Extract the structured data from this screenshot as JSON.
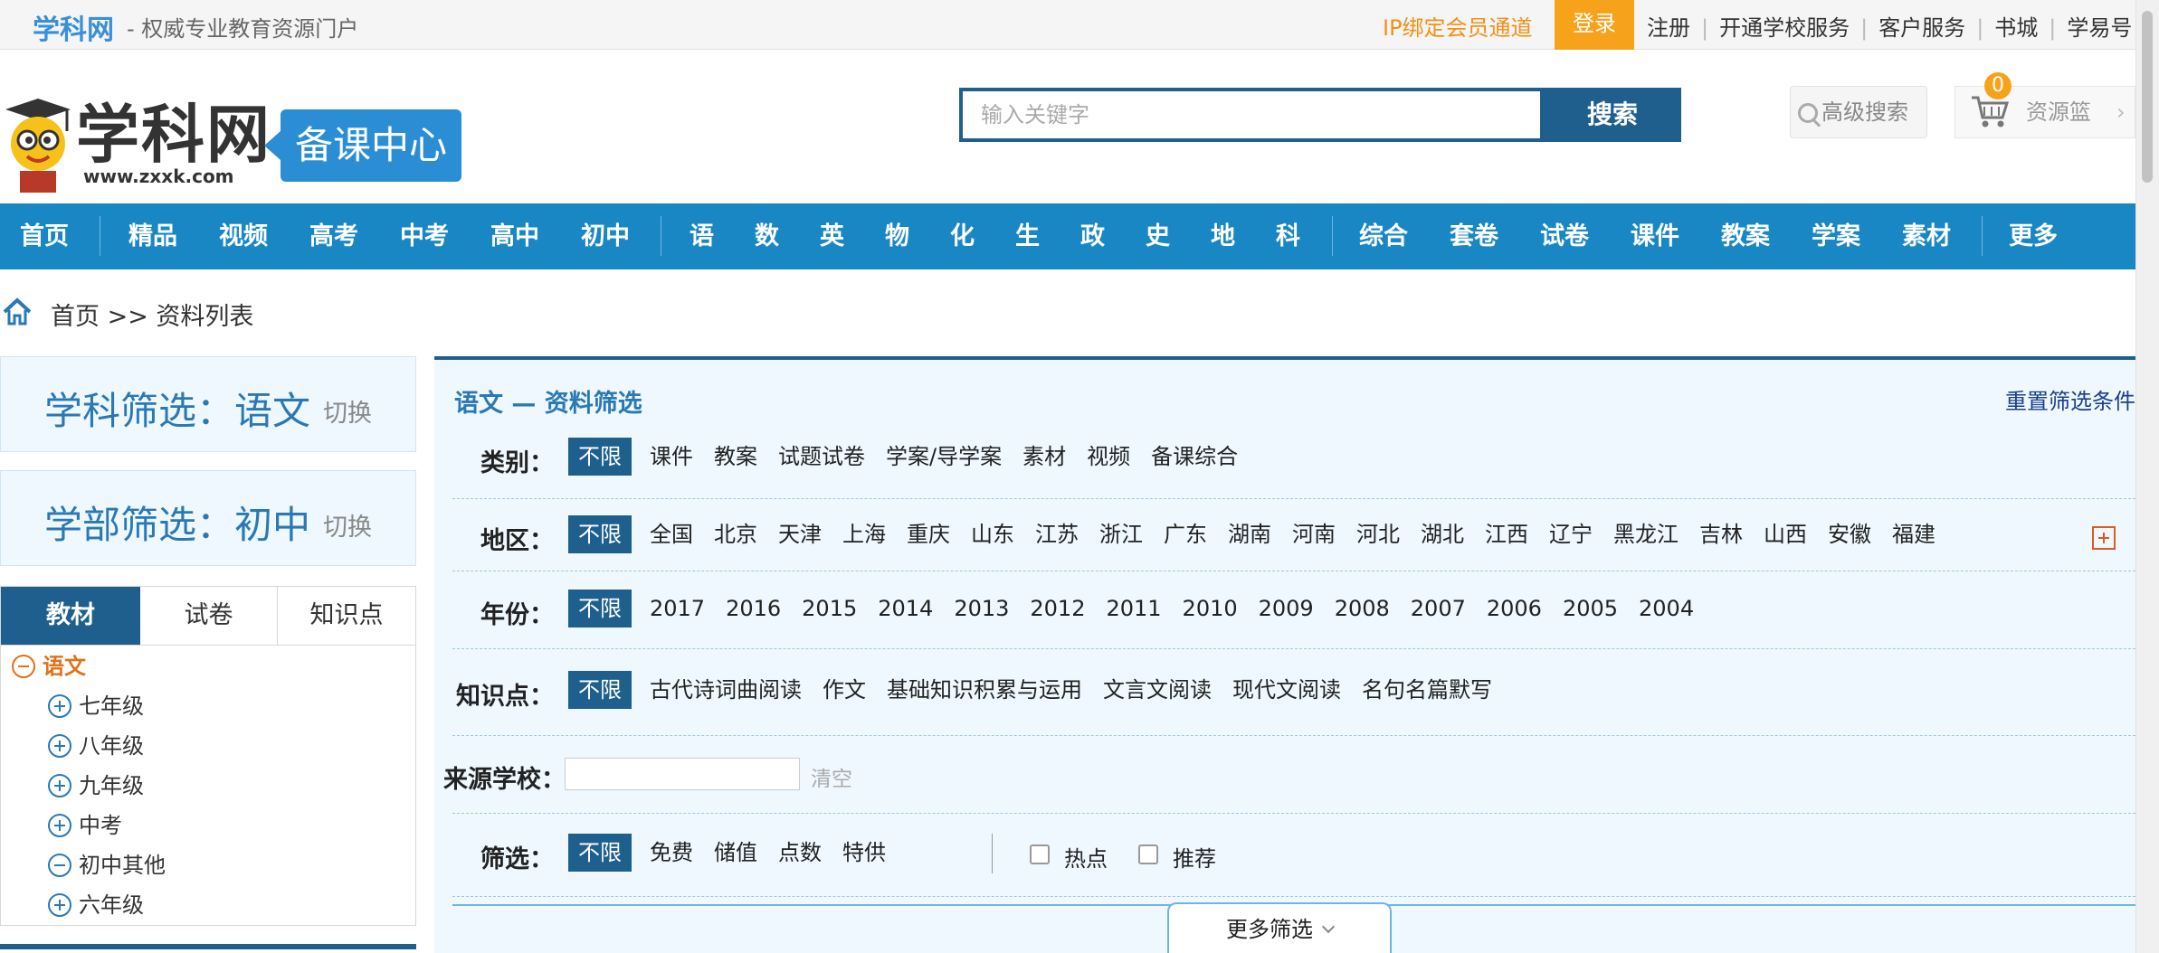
{
  "topbar": {
    "site_name": "学科网",
    "slogan": "- 权威专业教育资源门户",
    "ip_channel": "IP绑定会员通道",
    "login": "登录",
    "links": [
      "注册",
      "开通学校服务",
      "客户服务",
      "书城",
      "学易号"
    ]
  },
  "header": {
    "logo_text": "学科网",
    "logo_url": "www.zxxk.com",
    "badge": "备课中心",
    "search_placeholder": "输入关键字",
    "search_button": "搜索",
    "advanced_search": "高级搜索",
    "basket_count": "0",
    "basket_label": "资源篮",
    "basket_arrow": "›"
  },
  "nav": {
    "items": [
      "首页",
      "精品",
      "视频",
      "高考",
      "中考",
      "高中",
      "初中",
      "语",
      "数",
      "英",
      "物",
      "化",
      "生",
      "政",
      "史",
      "地",
      "科",
      "综合",
      "套卷",
      "试卷",
      "课件",
      "教案",
      "学案",
      "素材",
      "更多"
    ]
  },
  "breadcrumb": "首页 >> 资料列表",
  "left": {
    "subject_filter": "学科筛选：语文",
    "dept_filter": "学部筛选：初中",
    "switch": "切换",
    "tabs": [
      "教材",
      "试卷",
      "知识点"
    ],
    "tree_root": "语文",
    "tree_items": [
      "七年级",
      "八年级",
      "九年级",
      "中考",
      "初中其他",
      "六年级"
    ]
  },
  "panel": {
    "title": "语文 — 资料筛选",
    "reset": "重置筛选条件",
    "rows": {
      "category": {
        "label": "类别：",
        "options": [
          "不限",
          "课件",
          "教案",
          "试题试卷",
          "学案/导学案",
          "素材",
          "视频",
          "备课综合"
        ]
      },
      "region": {
        "label": "地区：",
        "options": [
          "不限",
          "全国",
          "北京",
          "天津",
          "上海",
          "重庆",
          "山东",
          "江苏",
          "浙江",
          "广东",
          "湖南",
          "河南",
          "河北",
          "湖北",
          "江西",
          "辽宁",
          "黑龙江",
          "吉林",
          "山西",
          "安徽",
          "福建"
        ]
      },
      "year": {
        "label": "年份：",
        "options": [
          "不限",
          "2017",
          "2016",
          "2015",
          "2014",
          "2013",
          "2012",
          "2011",
          "2010",
          "2009",
          "2008",
          "2007",
          "2006",
          "2005",
          "2004"
        ]
      },
      "knowledge": {
        "label": "知识点：",
        "options": [
          "不限",
          "古代诗词曲阅读",
          "作文",
          "基础知识积累与运用",
          "文言文阅读",
          "现代文阅读",
          "名句名篇默写"
        ]
      },
      "school": {
        "label": "来源学校：",
        "clear": "清空"
      },
      "filter": {
        "label": "筛选：",
        "options": [
          "不限",
          "免费",
          "储值",
          "点数",
          "特供"
        ],
        "checks": [
          "热点",
          "推荐"
        ]
      }
    },
    "more_filter": "更多筛选"
  },
  "colors": {
    "nav_blue": "#1a87c5",
    "dark_blue": "#1e5f8e",
    "orange": "#f7a21b"
  }
}
